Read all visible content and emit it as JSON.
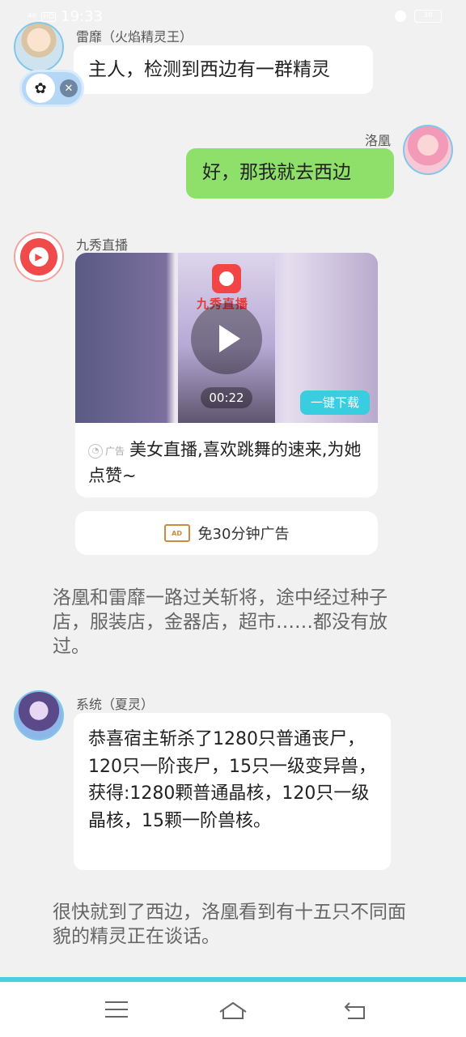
{
  "status_bar": {
    "time": "19:33",
    "signal": "46",
    "network": "HD",
    "battery": "38"
  },
  "messages": [
    {
      "sender": "雷靡（火焰精灵王）",
      "text": "主人，检测到西边有一群精灵"
    },
    {
      "sender": "洛凰",
      "text": "好，那我就去西边"
    }
  ],
  "ad": {
    "sender": "九秀直播",
    "brand": "九秀直播",
    "duration": "00:22",
    "download_label": "一键下载",
    "tag": "广告",
    "text": "美女直播,喜欢跳舞的速来,为她点赞~",
    "adfree_label": "免30分钟广告",
    "ticket_icon_text": "AD"
  },
  "narration": [
    "洛凰和雷靡一路过关斩将，途中经过种子店，服装店，金器店，超市……都没有放过。",
    "很快就到了西边，洛凰看到有十五只不同面貌的精灵正在谈话。"
  ],
  "system_message": {
    "sender": "系统（夏灵）",
    "text": "恭喜宿主斩杀了1280只普通丧尸，120只一阶丧尸，15只一级变异兽，获得:1280颗普通晶核，120只一级晶核，15颗一阶兽核。"
  },
  "icons": {
    "float_paw": "paw-icon",
    "float_close": "close-icon",
    "play": "play-icon",
    "ticket": "ad-ticket-icon",
    "nav_menu": "menu-icon",
    "nav_home": "home-icon",
    "nav_back": "back-icon"
  },
  "colors": {
    "accent": "#49cfe1",
    "my_bubble": "#8ee06a",
    "download": "#39cde0",
    "background": "#f1f1f1"
  }
}
